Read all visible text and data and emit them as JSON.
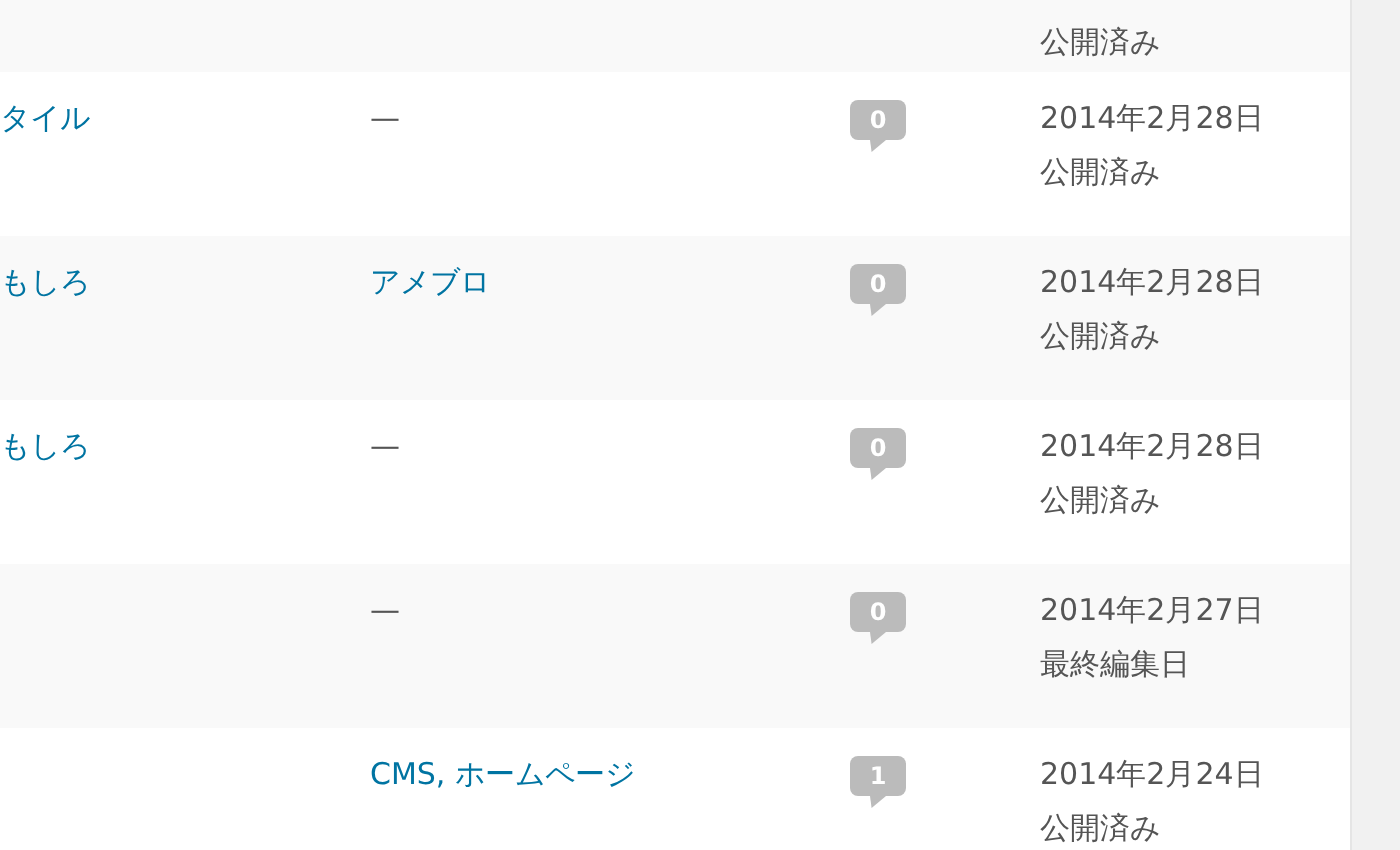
{
  "top_row": {
    "status": "公開済み"
  },
  "rows": [
    {
      "title": "タイル",
      "tags": "—",
      "tags_link": false,
      "comments": "0",
      "date": "2014年2月28日",
      "status": "公開済み"
    },
    {
      "title": "もしろ",
      "tags": "アメブロ",
      "tags_link": true,
      "comments": "0",
      "date": "2014年2月28日",
      "status": "公開済み"
    },
    {
      "title": "もしろ",
      "tags": "—",
      "tags_link": false,
      "comments": "0",
      "date": "2014年2月28日",
      "status": "公開済み"
    },
    {
      "tags": "—",
      "tags_link": false,
      "comments": "0",
      "date": "2014年2月27日",
      "status": "最終編集日"
    },
    {
      "tags": "CMS, ホームページ",
      "tags_link": true,
      "comments": "1",
      "date": "2014年2月24日",
      "status": "公開済み"
    }
  ]
}
